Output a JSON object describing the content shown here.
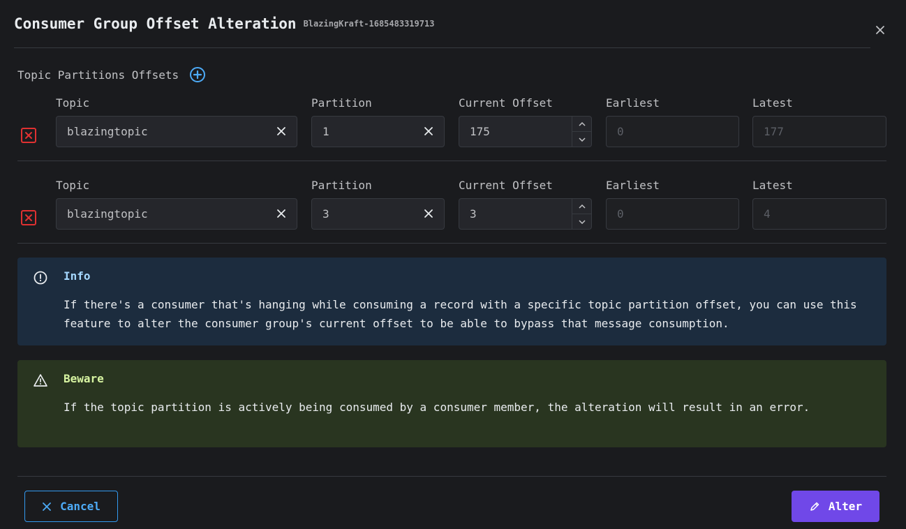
{
  "modal": {
    "title": "Consumer Group Offset Alteration",
    "subtitle": "BlazingKraft-1685483319713"
  },
  "section": {
    "label": "Topic Partitions Offsets"
  },
  "columns": {
    "topic": "Topic",
    "partition": "Partition",
    "current_offset": "Current Offset",
    "earliest": "Earliest",
    "latest": "Latest"
  },
  "rows": [
    {
      "topic": "blazingtopic",
      "partition": "1",
      "current_offset": "175",
      "earliest": "0",
      "latest": "177"
    },
    {
      "topic": "blazingtopic",
      "partition": "3",
      "current_offset": "3",
      "earliest": "0",
      "latest": "4"
    }
  ],
  "alerts": {
    "info": {
      "title": "Info",
      "body": "If there's a consumer that's hanging while consuming a record with a specific topic partition offset, you can use this feature to alter the consumer group's current offset to be able to bypass that message consumption."
    },
    "warn": {
      "title": "Beware",
      "body": "If the topic partition is actively being consumed by a consumer member, the alteration will result in an error."
    }
  },
  "footer": {
    "cancel_label": "Cancel",
    "alter_label": "Alter"
  },
  "colors": {
    "accent": "#7048e8",
    "cancel": "#339af0",
    "danger": "#e03131",
    "info_bg": "#1c2c3e",
    "warn_bg": "#293520"
  },
  "icons": [
    "close-icon",
    "plus-circle-icon",
    "delete-square-icon",
    "clear-icon",
    "chevron-up-icon",
    "chevron-down-icon",
    "info-circle-icon",
    "alert-triangle-icon",
    "x-icon",
    "pencil-icon"
  ]
}
